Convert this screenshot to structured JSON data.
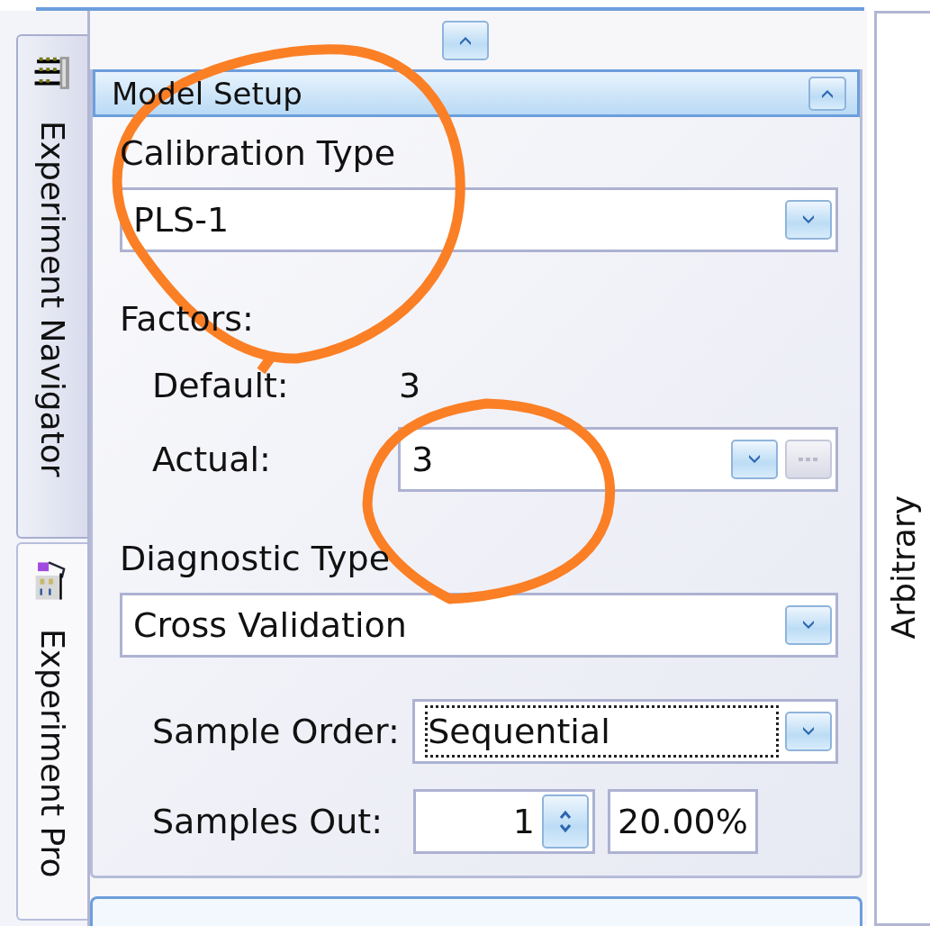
{
  "side_tabs": [
    {
      "label": "Experiment Navigator",
      "selected": false,
      "kind": "rack"
    },
    {
      "label": "Experiment Pro",
      "selected": true,
      "kind": "building"
    }
  ],
  "panel": {
    "title": "Model Setup",
    "expanded": true,
    "calibration_type": {
      "label": "Calibration Type",
      "value": "PLS-1"
    },
    "factors": {
      "label": "Factors:",
      "default_label": "Default:",
      "default_value": "3",
      "actual_label": "Actual:",
      "actual_value": "3",
      "browse_disabled": true
    },
    "diagnostic_type": {
      "label": "Diagnostic Type",
      "value": "Cross Validation"
    },
    "sample_order": {
      "label": "Sample Order:",
      "value": "Sequential",
      "focused": true
    },
    "samples_out": {
      "label": "Samples Out:",
      "value": "1",
      "percent": "20.00%"
    }
  },
  "right_panel": {
    "axis_label": "Arbitrary"
  }
}
